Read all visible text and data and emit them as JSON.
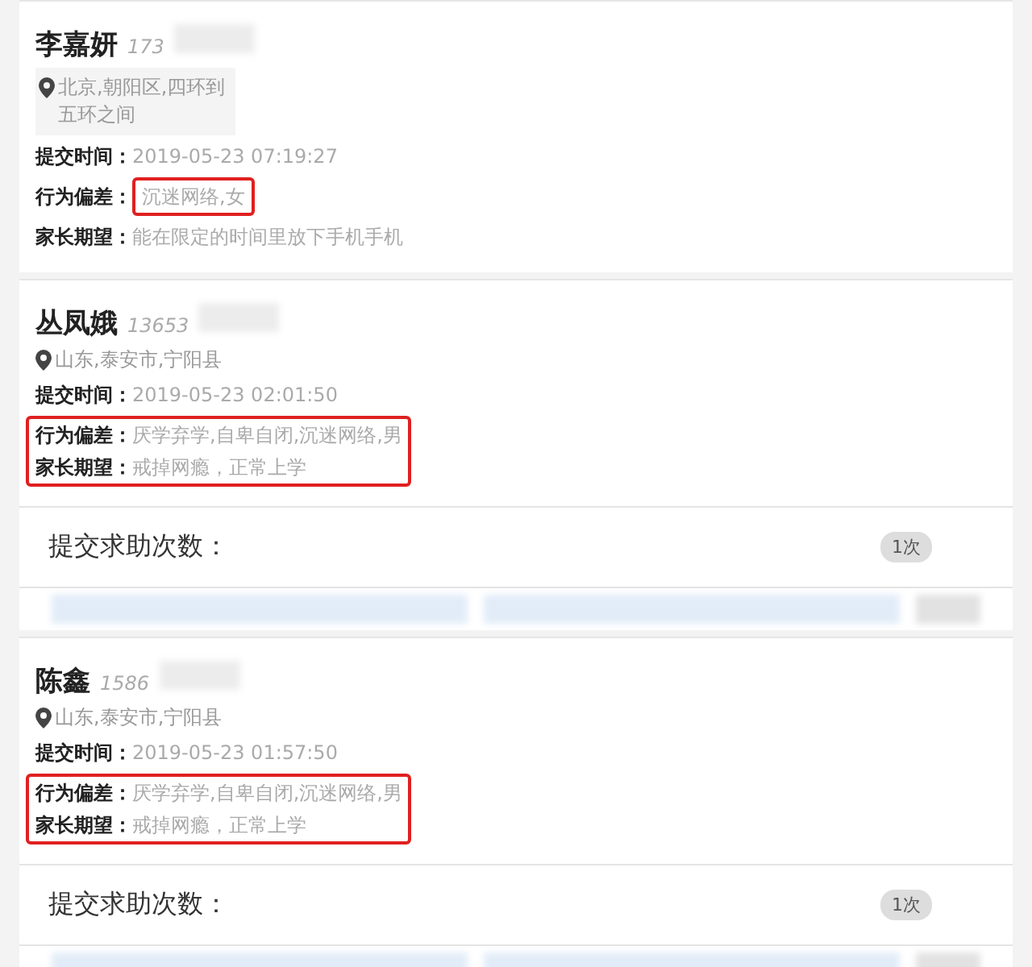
{
  "cards": [
    {
      "kind": "value-frame",
      "name": "李嘉妍",
      "phone": "173",
      "address": "北京,朝阳区,四环到五环之间",
      "address_boxed": true,
      "fields": [
        {
          "label": "提交时间：",
          "value": "2019-05-23 07:19:27",
          "highlighted": false
        },
        {
          "label": "行为偏差：",
          "value": "沉迷网络,女",
          "highlighted": true
        },
        {
          "label": "家长期望：",
          "value": "能在限定的时间里放下手机手机",
          "highlighted": false
        }
      ]
    },
    {
      "kind": "row-frame",
      "name": "丛凤娥",
      "phone": "13653",
      "address": "山东,泰安市,宁阳县",
      "address_boxed": false,
      "fields": [
        {
          "label": "提交时间：",
          "value": "2019-05-23 02:01:50",
          "highlighted": false
        },
        {
          "label": "行为偏差：",
          "value": "厌学弃学,自卑自闭,沉迷网络,男",
          "highlighted": true
        },
        {
          "label": "家长期望：",
          "value": "戒掉网瘾，正常上学",
          "highlighted": true
        }
      ],
      "count_label": "提交求助次数：",
      "count": "1次"
    },
    {
      "kind": "row-frame",
      "name": "陈鑫",
      "phone": "1586",
      "address": "山东,泰安市,宁阳县",
      "address_boxed": false,
      "fields": [
        {
          "label": "提交时间：",
          "value": "2019-05-23 01:57:50",
          "highlighted": false
        },
        {
          "label": "行为偏差：",
          "value": "厌学弃学,自卑自闭,沉迷网络,男",
          "highlighted": true
        },
        {
          "label": "家长期望：",
          "value": "戒掉网瘾，正常上学",
          "highlighted": true
        }
      ],
      "count_label": "提交求助次数：",
      "count": "1次"
    }
  ]
}
